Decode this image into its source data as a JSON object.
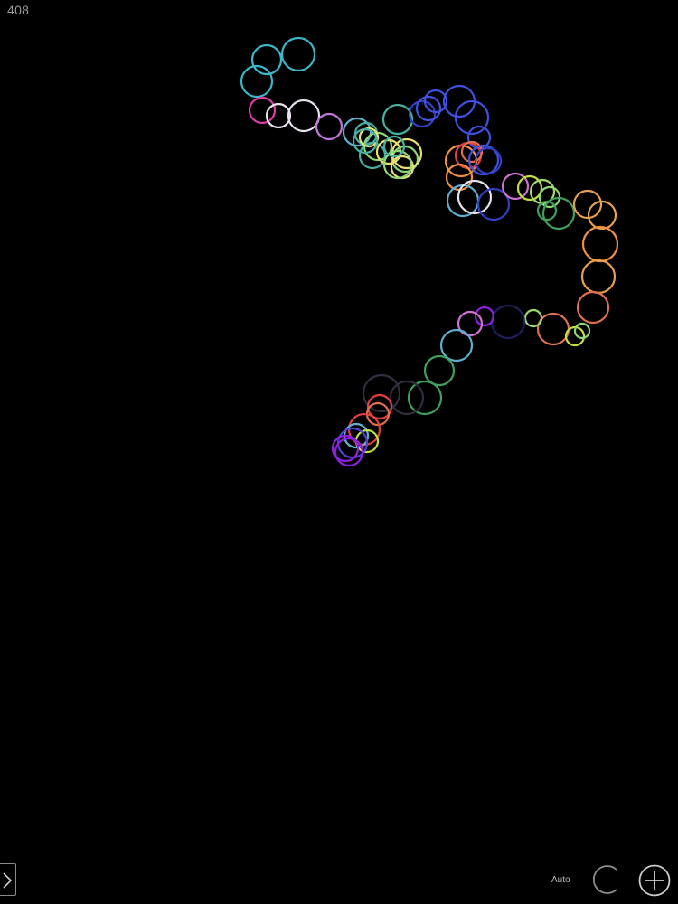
{
  "counter": "408",
  "controls": {
    "auto_label": "Auto",
    "side_toggle_icon": "chevron-right-icon",
    "clear_icon": "refresh-arc-icon",
    "add_icon": "plus-circle-icon"
  },
  "theme": {
    "background": "#000000",
    "ui_color": "#cfcfcf"
  },
  "palette": [
    "#3cb6c8",
    "#e03ca8",
    "#e9e0ee",
    "#c078d8",
    "#5fb0d0",
    "#48b0a0",
    "#8ed878",
    "#e8e070",
    "#4050e0",
    "#3040c0",
    "#e04040",
    "#f09040",
    "#e8a050",
    "#e07050",
    "#40a060",
    "#a0d870",
    "#202060",
    "#303040",
    "#d070d0",
    "#c0e040",
    "#9020e0",
    "#5040d0"
  ]
}
